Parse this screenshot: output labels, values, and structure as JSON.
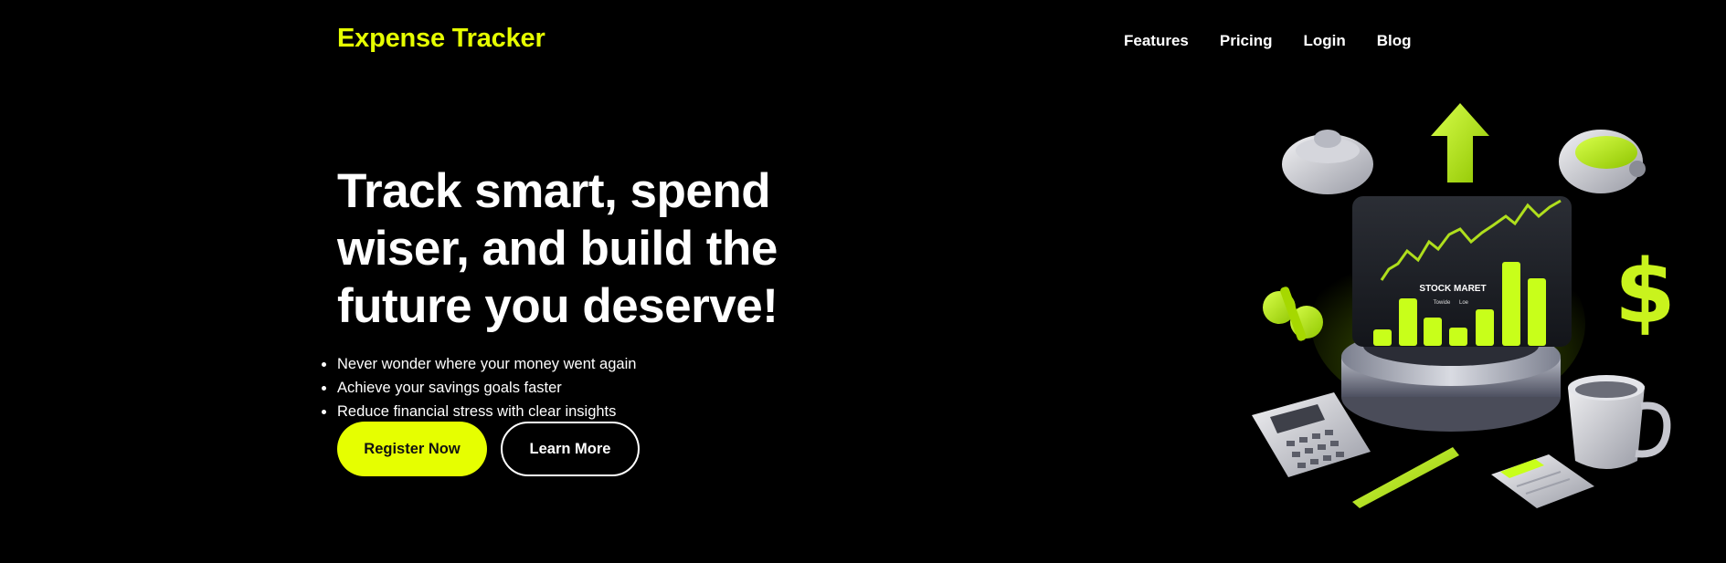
{
  "header": {
    "logo": "Expense Tracker",
    "nav": [
      "Features",
      "Pricing",
      "Login",
      "Blog"
    ]
  },
  "hero": {
    "headline_lines": [
      "Track smart, spend",
      "wiser, and build the",
      "future you deserve!"
    ],
    "bullets": [
      "Never wonder where your money went again",
      "Achieve your savings goals faster",
      "Reduce financial stress with clear insights"
    ],
    "primary_cta": "Register Now",
    "secondary_cta": "Learn More"
  },
  "illustration": {
    "screen_title": "STOCK MARET",
    "screen_sub_left": "Towide",
    "screen_sub_right": "Loe",
    "dollar_symbol": "$",
    "percent_symbol": "%"
  },
  "colors": {
    "background": "#000000",
    "accent": "#e6ff00",
    "text": "#ffffff"
  }
}
